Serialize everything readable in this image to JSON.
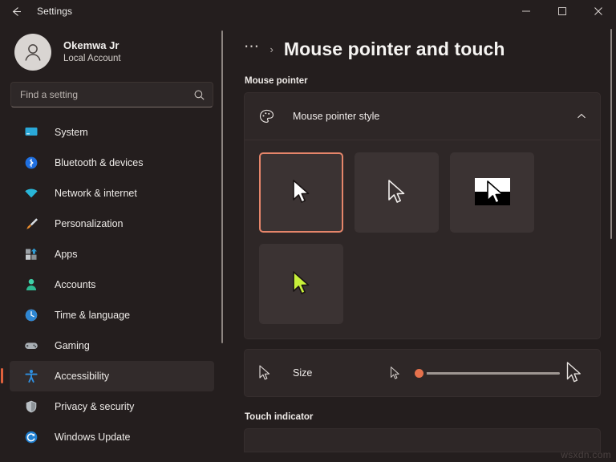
{
  "titlebar": {
    "back_icon": "arrow-left-icon",
    "title": "Settings",
    "minimize_label": "—",
    "maximize_label": "☐",
    "close_label": "✕"
  },
  "account": {
    "avatar_icon": "person-avatar-icon",
    "name": "Okemwa Jr",
    "subtitle": "Local Account"
  },
  "search": {
    "placeholder": "Find a setting",
    "icon": "search-icon"
  },
  "sidebar": {
    "items": [
      {
        "label": "System",
        "icon": "monitor-icon",
        "active": false
      },
      {
        "label": "Bluetooth & devices",
        "icon": "bluetooth-icon",
        "active": false
      },
      {
        "label": "Network & internet",
        "icon": "wifi-icon",
        "active": false
      },
      {
        "label": "Personalization",
        "icon": "paintbrush-icon",
        "active": false
      },
      {
        "label": "Apps",
        "icon": "apps-grid-icon",
        "active": false
      },
      {
        "label": "Accounts",
        "icon": "account-person-icon",
        "active": false
      },
      {
        "label": "Time & language",
        "icon": "clock-icon",
        "active": false
      },
      {
        "label": "Gaming",
        "icon": "gamepad-icon",
        "active": false
      },
      {
        "label": "Accessibility",
        "icon": "accessibility-icon",
        "active": true
      },
      {
        "label": "Privacy & security",
        "icon": "shield-icon",
        "active": false
      },
      {
        "label": "Windows Update",
        "icon": "update-refresh-icon",
        "active": false
      }
    ]
  },
  "content": {
    "breadcrumb_overflow": "⋯",
    "breadcrumb_separator": "›",
    "page_title": "Mouse pointer and touch",
    "section_mouse_pointer": "Mouse pointer",
    "section_touch_indicator": "Touch indicator",
    "pointer_style_card": {
      "icon": "palette-icon",
      "title": "Mouse pointer style",
      "expand_icon": "chevron-up-icon",
      "expanded": true,
      "options": [
        {
          "name": "White",
          "selected": true
        },
        {
          "name": "Black",
          "selected": false
        },
        {
          "name": "Inverted",
          "selected": false
        },
        {
          "name": "Custom",
          "selected": false,
          "color": "#c7f03a"
        }
      ]
    },
    "size_card": {
      "label": "Size",
      "icon": "cursor-small-icon",
      "slider": {
        "value": 1,
        "min": 1,
        "max": 15,
        "thumb_color": "#e5714c"
      },
      "min_icon": "cursor-tiny-icon",
      "max_icon": "cursor-large-icon"
    }
  },
  "watermark": "wsxdn.com",
  "colors": {
    "window_bg": "#241e1e",
    "card_bg": "#2e2727",
    "tile_bg": "#3b3333",
    "accent": "#e0613c",
    "selected_border": "#e5856a"
  }
}
